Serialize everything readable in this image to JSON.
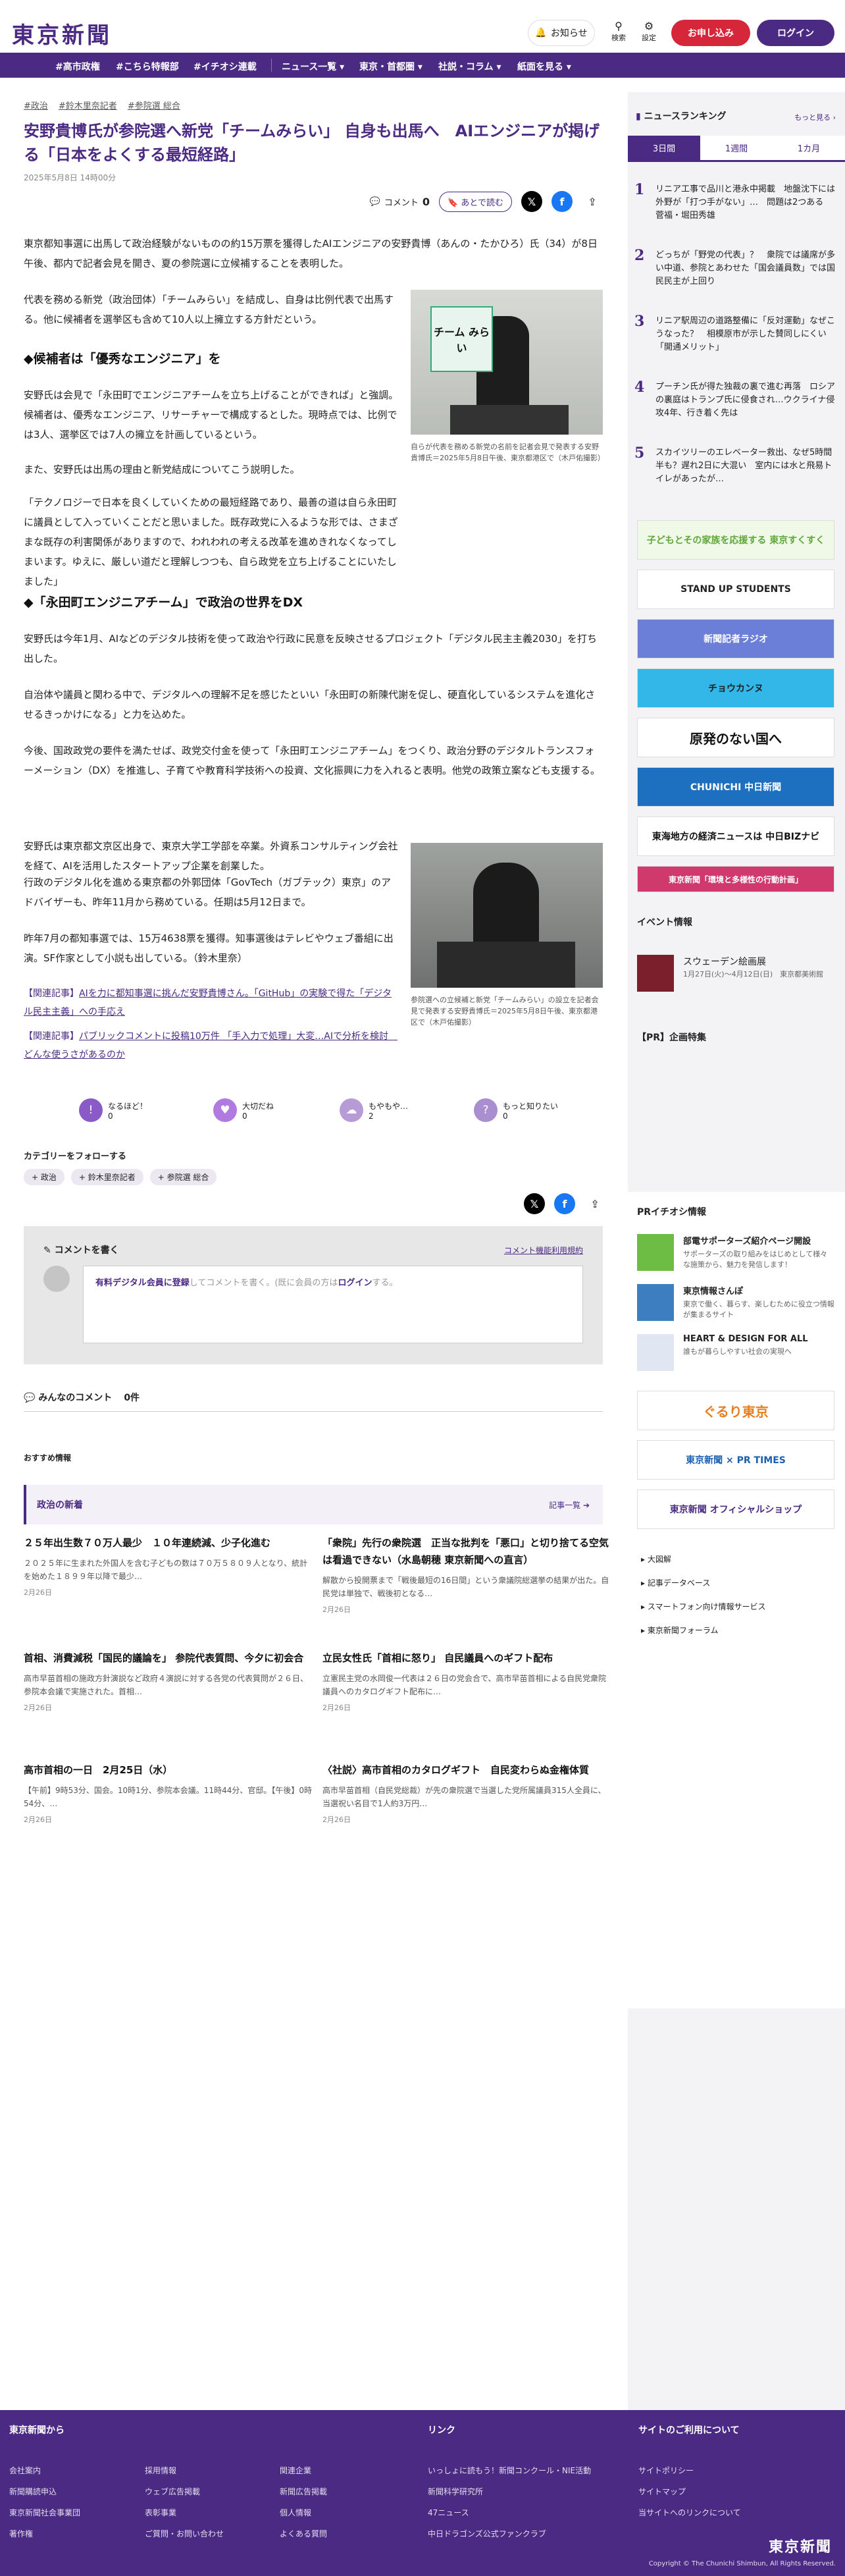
{
  "header": {
    "logo": "東京新聞",
    "notice": "お知らせ",
    "search": "検索",
    "settings": "設定",
    "signup": "お申し込み",
    "login": "ログイン"
  },
  "nav": [
    "#高市政権",
    "#こちら特報部",
    "#イチオシ連載",
    "ニュース一覧 ▾",
    "東京・首都圏 ▾",
    "社説・コラム ▾",
    "紙面を見る ▾"
  ],
  "article": {
    "tags": [
      "#政治",
      "#鈴木里奈記者",
      "#参院選 総合"
    ],
    "title": "安野貴博氏が参院選へ新党「チームみらい」 自身も出馬へ　AIエンジニアが掲げる「日本をよくする最短経路」",
    "date": "2025年5月8日 14時00分",
    "comment_label": "コメント",
    "comment_count": "0",
    "later_label": "あとで読む",
    "p1": "東京都知事選に出馬して政治経験がないものの約15万票を獲得したAIエンジニアの安野貴博（あんの・たかひろ）氏（34）が8日午後、都内で記者会見を開き、夏の参院選に立候補することを表明した。",
    "p2": "代表を務める新党（政治団体）「チームみらい」を結成し、自身は比例代表で出馬する。他に候補者を選挙区も含めて10人以上擁立する方針だという。",
    "h1": "◆候補者は「優秀なエンジニア」を",
    "p3": "安野氏は会見で「永田町でエンジニアチームを立ち上げることができれば」と強調。候補者は、優秀なエンジニア、リサーチャーで構成するとした。現時点では、比例では3人、選挙区では7人の擁立を計画しているという。",
    "p4": "また、安野氏は出馬の理由と新党結成についてこう説明した。",
    "p5": "「テクノロジーで日本を良くしていくための最短経路であり、最善の道は自ら永田町に議員として入っていくことだと思いました。既存政党に入るような形では、さまざまな既存の利害関係がありますので、われわれの考える改革を進めきれなくなってしまいます。ゆえに、厳しい道だと理解しつつも、自ら政党を立ち上げることにいたしました」",
    "h2": "◆「永田町エンジニアチーム」で政治の世界をDX",
    "p6": "安野氏は今年1月、AIなどのデジタル技術を使って政治や行政に民意を反映させるプロジェクト「デジタル民主主義2030」を打ち出した。",
    "p7": "自治体や議員と関わる中で、デジタルへの理解不足を感じたといい「永田町の新陳代謝を促し、硬直化しているシステムを進化させるきっかけになる」と力を込めた。",
    "p8": "今後、国政政党の要件を満たせば、政党交付金を使って「永田町エンジニアチーム」をつくり、政治分野のデジタルトランスフォーメーション（DX）を推進し、子育てや教育科学技術への投資、文化振興に力を入れると表明。他党の政策立案なども支援する。",
    "p9": "安野氏は東京都文京区出身で、東京大学工学部を卒業。外資系コンサルティング会社を経て、AIを活用したスタートアップ企業を創業した。",
    "p10": "行政のデジタル化を進める東京都の外郭団体「GovTech（ガブテック）東京」のアドバイザーも、昨年11月から務めている。任期は5月12日まで。",
    "p11": "昨年7月の都知事選では、15万4638票を獲得。知事選後はテレビやウェブ番組に出演。SF作家として小説も出している。（鈴木里奈）",
    "rel1_pre": "【関連記事】",
    "rel1": "AIを力に都知事選に挑んだ安野貴博さん。「GitHub」の実験で得た「デジタル民主主義」への手応え",
    "rel2_pre": "【関連記事】",
    "rel2": "パブリックコメントに投稿10万件 「手入力で処理」大変…AIで分析を検討　どんな使うさがあるのか",
    "cap1": "自らが代表を務める新党の名前を記者会見で発表する安野貴博氏＝2025年5月8日午後、東京都港区で（木戸佑撮影）",
    "cap2": "参院選への立候補と新党「チームみらい」の設立を記者会見で発表する安野貴博氏＝2025年5月8日午後、東京都港区で（木戸佑撮影）",
    "sign_text": "チーム みらい"
  },
  "reactions": [
    {
      "label": "なるほど！",
      "count": "0",
      "color": "#8a5bc7"
    },
    {
      "label": "大切だね",
      "count": "0",
      "color": "#b07ae0"
    },
    {
      "label": "もやもや…",
      "count": "2",
      "color": "#b69bd6"
    },
    {
      "label": "もっと知りたい",
      "count": "0",
      "color": "#a98ed0"
    }
  ],
  "follow": {
    "title": "カテゴリーをフォローする",
    "tags": [
      "+ 政治",
      "+ 鈴木里奈記者",
      "+ 参院選 総合"
    ]
  },
  "comment_box": {
    "title": "コメントを書く",
    "rules": "コメント機能利用規約",
    "text_a": "有料デジタル会員に登録",
    "text_b": "してコメントを書く。(既に会員の方は",
    "text_c": "ログイン",
    "text_d": "する。"
  },
  "all_comments": {
    "label": "みんなのコメント",
    "count": "0件"
  },
  "recommend": {
    "label": "おすすめ情報",
    "box_title": "政治の新着",
    "more": "記事一覧 ➔"
  },
  "cards": [
    {
      "title": "２５年出生数７０万人最少　１０年連続減、少子化進む",
      "body": "２０２５年に生まれた外国人を含む子どもの数は７０万５８０９人となり、統計を始めた１８９９年以降で最少…",
      "date": "2月26日"
    },
    {
      "title": "「衆院」先行の衆院選　正当な批判を「悪口」と切り捨てる空気は看過できない（水島朝穂 東京新聞への直言）",
      "body": "解散から投開票まで「戦後最短の16日間」という衆議院総選挙の結果が出た。自民党は単独で、戦後初となる…",
      "date": "2月26日"
    },
    {
      "title": "首相、消費減税「国民的議論を」 参院代表質問、今夕に初会合",
      "body": "高市早苗首相の施政方針演説など政府４演説に対する各党の代表質問が２６日、参院本会議で実施された。首相…",
      "date": "2月26日"
    },
    {
      "title": "立民女性氏「首相に怒り」 自民議員へのギフト配布",
      "body": "立憲民主党の水岡俊一代表は２６日の党会合で、高市早苗首相による自民党衆院議員へのカタログギフト配布に…",
      "date": "2月26日"
    },
    {
      "title": "高市首相の一日　2月25日（水）",
      "body": "【午前】9時53分、国会。10時1分、参院本会議。11時44分、官邸。【午後】0時54分、…",
      "date": "2月26日"
    },
    {
      "title": "〈社説〉高市首相のカタログギフト　自民変わらぬ金権体質",
      "body": "高市早苗首相（自民党総裁）が先の衆院選で当選した党所属議員315人全員に、当選祝い名目で1人約3万円…",
      "date": "2月26日"
    }
  ],
  "sidebar": {
    "ranking_title": "ニュースランキング",
    "ranking_more": "もっと見る ›",
    "tabs": [
      "3日間",
      "1週間",
      "1カ月"
    ],
    "ranks": [
      {
        "n": "1",
        "t": "リニア工事で品川と港永中掲載　地盤沈下には外野が「打つ手がない」…　問題は2つある　菅福・堀田秀雄"
      },
      {
        "n": "2",
        "t": "どっちが「野党の代表」？　衆院では議席が多い中道、参院とあわせた「国会議員数」では国民民主が上回り"
      },
      {
        "n": "3",
        "t": "リニア駅周辺の道路整備に「反対運動」なぜこうなった？　相模原市が示した賛同しにくい「開通メリット」"
      },
      {
        "n": "4",
        "t": "プーチン氏が得た独裁の裏で進む再落　ロシアの裏庭はトランプ氏に侵食され…ウクライナ侵攻4年、行き着く先は"
      },
      {
        "n": "5",
        "t": "スカイツリーのエレベーター救出、なぜ5時間半も？遅れ2日に大混い　室内には水と飛易トイレがあったが…"
      }
    ],
    "banners": [
      {
        "t": "子どもとその家族を応援する 東京すくすく",
        "c": "#5fa83c",
        "bg": "#f0f8e8"
      },
      {
        "t": "STAND UP STUDENTS",
        "c": "#222",
        "bg": "#fff"
      },
      {
        "t": "新聞記者ラジオ",
        "c": "#fff",
        "bg": "#6b7fd8"
      },
      {
        "t": "チョウカンヌ",
        "c": "#222",
        "bg": "#33b7e8"
      },
      {
        "t": "原発のない国へ",
        "c": "#111",
        "bg": "#fff"
      },
      {
        "t": "CHUNICHI 中日新聞",
        "c": "#fff",
        "bg": "#1d6fc0"
      },
      {
        "t": "東海地方の経済ニュースは 中日BIZナビ",
        "c": "#111",
        "bg": "#fff"
      },
      {
        "t": "東京新聞「環境と多様性の行動計画」",
        "c": "#fff",
        "bg": "#d0396b"
      }
    ],
    "event_title": "イベント情報",
    "event": {
      "name": "スウェーデン絵画展",
      "date": "1月27日(火)〜4月12日(日)　東京都美術館"
    },
    "pr_title": "【PR】企画特集",
    "pr_event_title": "PRイチオシ情報",
    "pr_items": [
      {
        "t": "部電サポーターズ紹介ページ開設",
        "b": "サポーターズの取り組みをはじめとして様々な施策から、魅力を発信します！"
      },
      {
        "t": "東京情報さんぽ",
        "b": "東京で働く、暮らす、楽しむために役立つ情報が集まるサイト"
      },
      {
        "t": "HEART & DESIGN FOR ALL",
        "b": "誰もが暮らしやすい社会の実現へ"
      }
    ],
    "bottom_banners": [
      {
        "t": "ぐるり東京",
        "c": "#e67e22"
      },
      {
        "t": "東京新聞 × PR TIMES",
        "c": "#1b5fb0"
      },
      {
        "t": "東京新聞 オフィシャルショップ",
        "c": "#4b2a83"
      }
    ],
    "links": [
      "大図解",
      "記事データベース",
      "スマートフォン向け情報サービス",
      "東京新聞フォーラム"
    ]
  },
  "footer": {
    "col1_title": "東京新聞から",
    "col1": [
      "会社案内",
      "採用情報",
      "関連企業",
      "新聞購読申込",
      "ウェブ広告掲載",
      "新聞広告掲載",
      "東京新聞社会事業団",
      "表彰事業",
      "個人情報",
      "著作権",
      "ご質問・お問い合わせ",
      "よくある質問"
    ],
    "col2_title": "リンク",
    "col2": [
      "いっしょに読もう！新聞コンクール・NIE活動",
      "新聞科学研究所",
      "47ニュース",
      "中日ドラゴンズ公式ファンクラブ"
    ],
    "col3_title": "サイトのご利用について",
    "col3": [
      "サイトポリシー",
      "サイトマップ",
      "当サイトへのリンクについて"
    ],
    "logo": "東京新聞",
    "copyright": "Copyright © The Chunichi Shimbun, All Rights Reserved."
  }
}
